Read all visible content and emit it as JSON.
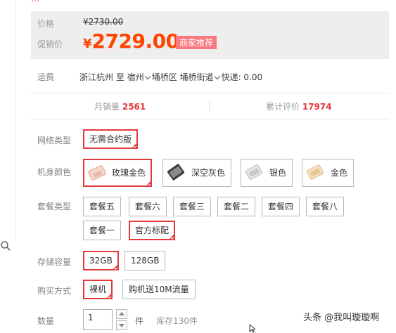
{
  "top_cut_text": "…",
  "price": {
    "label": "价格",
    "original": "¥2730.00",
    "promo_label": "促销价",
    "promo_currency": "¥",
    "promo_value": "2729.00",
    "badge": "商家推荐"
  },
  "shipping": {
    "label": "运费",
    "from": "浙江杭州",
    "to_word": "至",
    "province": "宿州",
    "district": "埇桥区",
    "street": "埇桥街道",
    "express": "快递: 0.00"
  },
  "stats": {
    "monthly_label": "月销量",
    "monthly_value": "2561",
    "reviews_label": "累计评价",
    "reviews_value": "17974"
  },
  "network": {
    "label": "网络类型",
    "options": [
      "无需合约版"
    ]
  },
  "color": {
    "label": "机身颜色",
    "options": [
      "玫瑰金色",
      "深空灰色",
      "银色",
      "金色"
    ]
  },
  "package": {
    "label": "套餐类型",
    "options": [
      "套餐五",
      "套餐六",
      "套餐三",
      "套餐二",
      "套餐四",
      "套餐八",
      "套餐一",
      "官方标配"
    ]
  },
  "storage": {
    "label": "存储容量",
    "options": [
      "32GB",
      "128GB"
    ]
  },
  "purchase": {
    "label": "购买方式",
    "options": [
      "裸机",
      "购机送10M流量"
    ]
  },
  "quantity": {
    "label": "数量",
    "value": "1",
    "unit": "件",
    "stock": "库存130件"
  },
  "watermark": "头条 @我叫璇璇啊",
  "colors": {
    "accent": "#e4393c",
    "price": "#ff4400",
    "badge": "#f8797f",
    "panel": "#eeeeee"
  }
}
